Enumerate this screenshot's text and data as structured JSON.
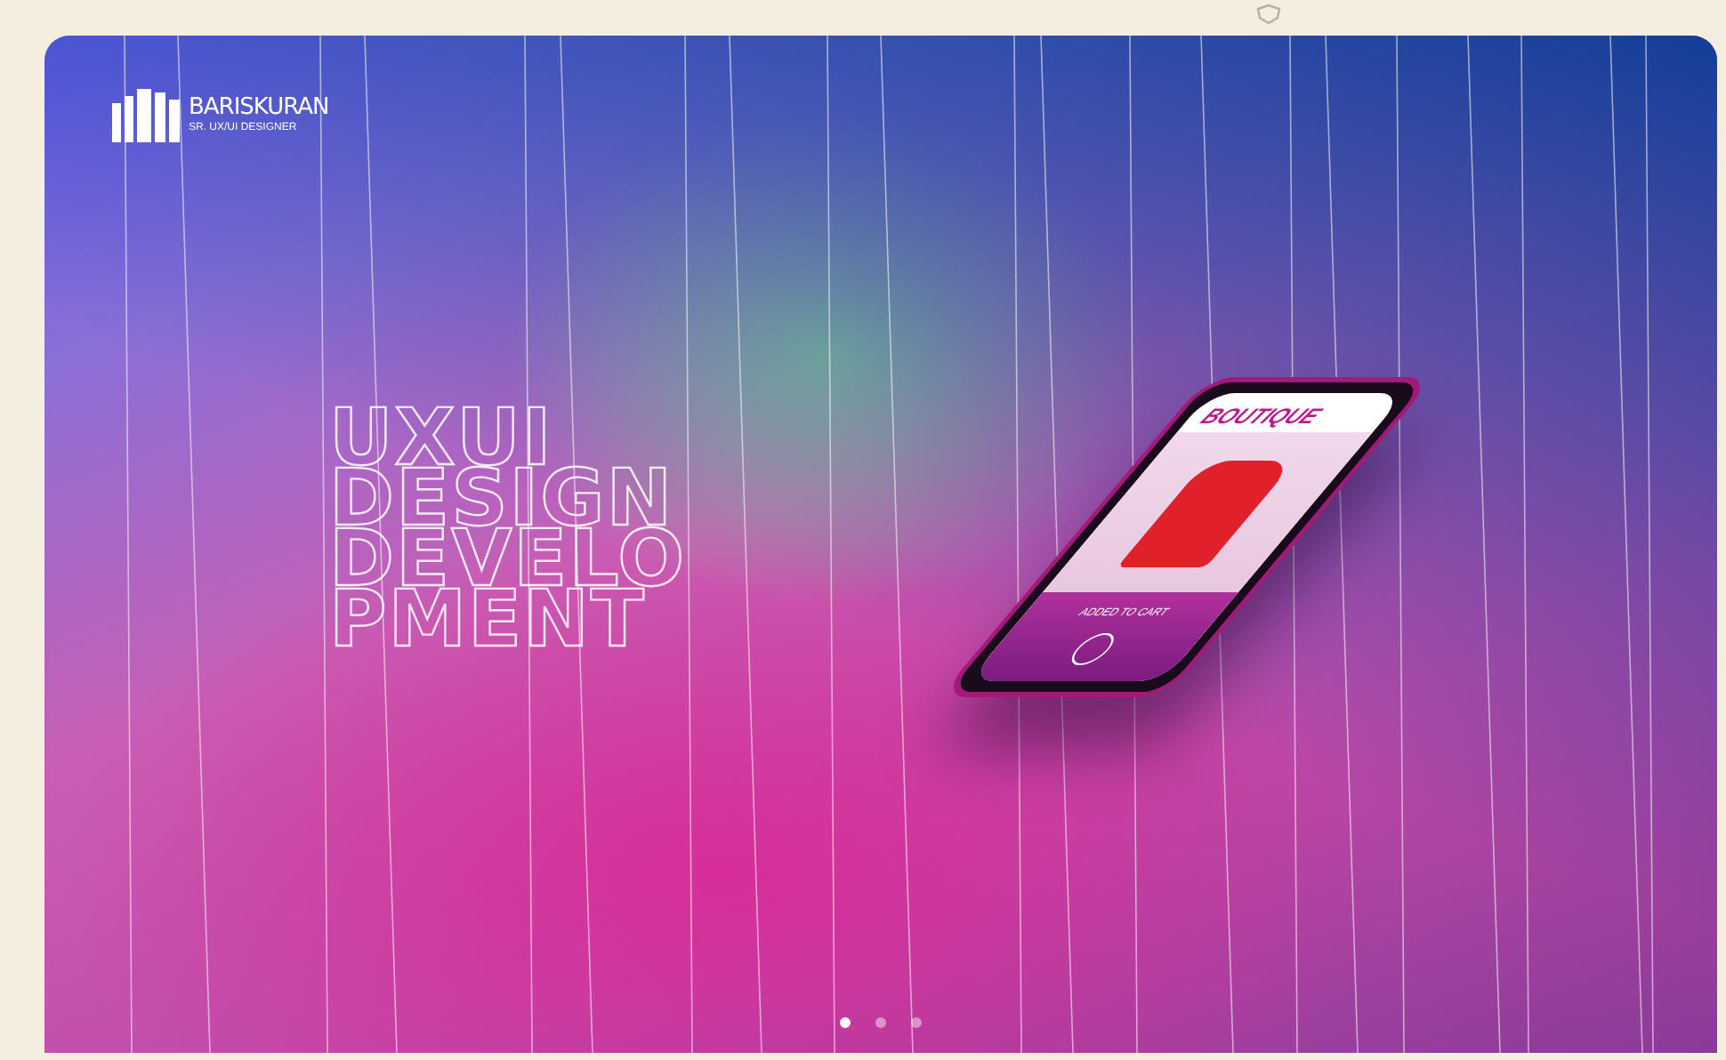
{
  "logo": {
    "name": "BARISKURAN",
    "subtitle": "SR. UX/UI DESIGNER"
  },
  "hero": {
    "lines": [
      "UXUI",
      "DESIGN",
      "DEVELO",
      "PMENT"
    ]
  },
  "phone": {
    "brand": "BOUTIQUE",
    "action": "ADDED TO CART"
  },
  "slider_dots": [
    {
      "selected": true
    },
    {
      "selected": false
    },
    {
      "selected": false
    }
  ]
}
